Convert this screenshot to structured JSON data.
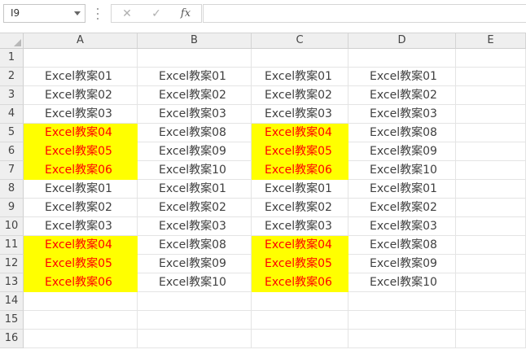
{
  "formula_bar": {
    "name_box": "I9",
    "cancel_icon": "cancel-icon",
    "enter_icon": "check-icon",
    "fx_label": "fx",
    "formula": ""
  },
  "columns": [
    "A",
    "B",
    "C",
    "D",
    "E"
  ],
  "rows": [
    "1",
    "2",
    "3",
    "4",
    "5",
    "6",
    "7",
    "8",
    "9",
    "10",
    "11",
    "12",
    "13",
    "14",
    "15",
    "16"
  ],
  "highlight": {
    "fill": "#ffff00",
    "text": "#ff0000"
  },
  "cells": [
    [
      "",
      "",
      "",
      "",
      ""
    ],
    [
      "Excel教案01",
      "Excel教案01",
      "Excel教案01",
      "Excel教案01",
      ""
    ],
    [
      "Excel教案02",
      "Excel教案02",
      "Excel教案02",
      "Excel教案02",
      ""
    ],
    [
      "Excel教案03",
      "Excel教案03",
      "Excel教案03",
      "Excel教案03",
      ""
    ],
    [
      "Excel教案04",
      "Excel教案08",
      "Excel教案04",
      "Excel教案08",
      ""
    ],
    [
      "Excel教案05",
      "Excel教案09",
      "Excel教案05",
      "Excel教案09",
      ""
    ],
    [
      "Excel教案06",
      "Excel教案10",
      "Excel教案06",
      "Excel教案10",
      ""
    ],
    [
      "Excel教案01",
      "Excel教案01",
      "Excel教案01",
      "Excel教案01",
      ""
    ],
    [
      "Excel教案02",
      "Excel教案02",
      "Excel教案02",
      "Excel教案02",
      ""
    ],
    [
      "Excel教案03",
      "Excel教案03",
      "Excel教案03",
      "Excel教案03",
      ""
    ],
    [
      "Excel教案04",
      "Excel教案08",
      "Excel教案04",
      "Excel教案08",
      ""
    ],
    [
      "Excel教案05",
      "Excel教案09",
      "Excel教案05",
      "Excel教案09",
      ""
    ],
    [
      "Excel教案06",
      "Excel教案10",
      "Excel教案06",
      "Excel教案10",
      ""
    ],
    [
      "",
      "",
      "",
      "",
      ""
    ],
    [
      "",
      "",
      "",
      "",
      ""
    ],
    [
      "",
      "",
      "",
      "",
      ""
    ]
  ],
  "highlighted_cells": [
    "A5",
    "A6",
    "A7",
    "C5",
    "C6",
    "C7",
    "A11",
    "A12",
    "A13",
    "C11",
    "C12",
    "C13"
  ]
}
